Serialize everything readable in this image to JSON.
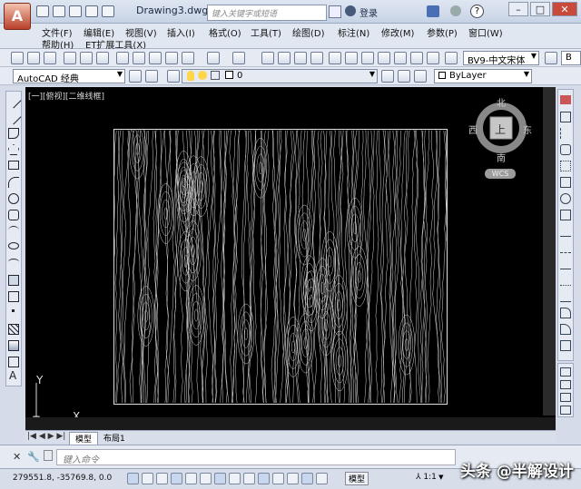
{
  "window": {
    "title": "Drawing3.dwg",
    "search_placeholder": "键入关键字或短语",
    "login_label": "登录",
    "help_symbol": "?"
  },
  "menu": {
    "row1": [
      "文件(F)",
      "编辑(E)",
      "视图(V)",
      "插入(I)",
      "格式(O)",
      "工具(T)",
      "绘图(D)",
      "标注(N)",
      "修改(M)",
      "参数(P)",
      "窗口(W)"
    ],
    "row2": [
      "帮助(H)",
      "ET扩展工具(X)"
    ]
  },
  "toolbar": {
    "workspace": "AutoCAD 经典",
    "layer": "0",
    "linetype": "ByLayer",
    "font_style": "BV9-中文宋体",
    "style_suffix": "B"
  },
  "viewport": {
    "label": "[一][俯视][二维线框]"
  },
  "viewcube": {
    "north": "北",
    "south": "南",
    "east": "东",
    "west": "西",
    "top": "上",
    "wcs": "WCS"
  },
  "ucs": {
    "x": "X",
    "y": "Y"
  },
  "tabs": [
    "模型",
    "布局1"
  ],
  "command": {
    "placeholder": "键入命令"
  },
  "status": {
    "coordinates": "279551.8, -35769.8, 0.0",
    "model_label": "模型",
    "scale": "1:1"
  },
  "watermark": "头条 @半解设计",
  "colors": {
    "canvas": "#000000",
    "ui": "#e6ebf3",
    "accent": "#b8402a"
  }
}
